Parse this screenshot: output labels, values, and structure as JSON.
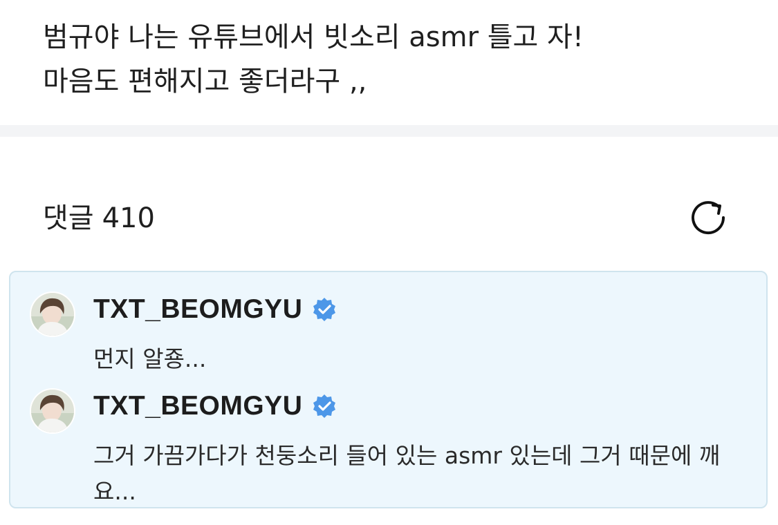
{
  "post": {
    "lines": [
      "범규야 나는 유튜브에서 빗소리 asmr 틀고 자!",
      "마음도 편해지고 좋더라구 ,,"
    ]
  },
  "comments": {
    "label": "댓글",
    "count": "410",
    "refresh_icon": "refresh-icon"
  },
  "replies": [
    {
      "username": "TXT_BEOMGYU",
      "verified_icon": "verified-badge-icon",
      "text": "먼지 알죵..."
    },
    {
      "username": "TXT_BEOMGYU",
      "verified_icon": "verified-badge-icon",
      "text": "그거 가끔가다가 천둥소리 들어 있는 asmr 있는데 그거 때문에 깨요..."
    }
  ],
  "colors": {
    "reply_background": "#edf7fd",
    "reply_border": "#cfe4ee",
    "verified_blue": "#4d97e8",
    "divider": "#f3f4f6"
  }
}
